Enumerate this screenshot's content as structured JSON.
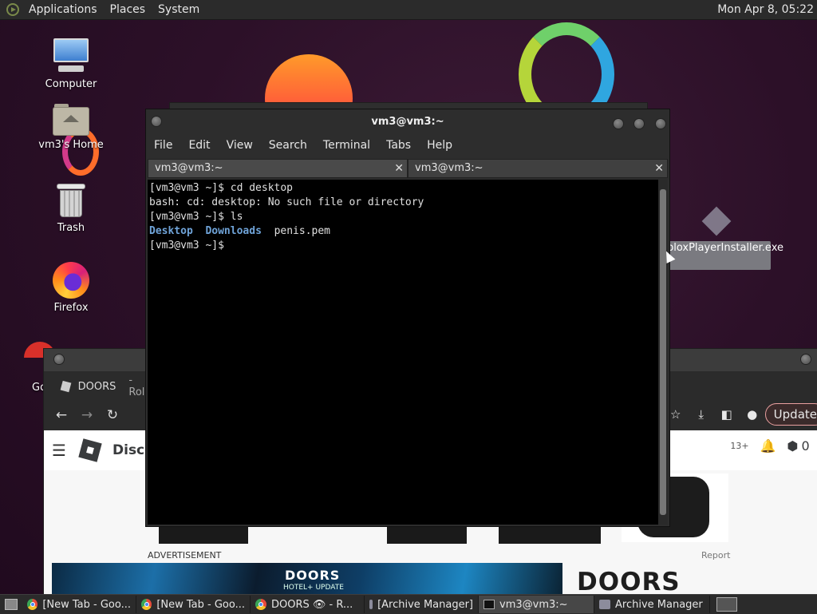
{
  "top_panel": {
    "menus": [
      "Applications",
      "Places",
      "System"
    ],
    "clock": "Mon Apr  8, 05:22"
  },
  "desktop": {
    "icons": [
      {
        "label": "Computer",
        "icon": "computer-icon"
      },
      {
        "label": "vm3's Home",
        "icon": "home-folder-icon"
      },
      {
        "label": "Trash",
        "icon": "trash-icon"
      },
      {
        "label": "Firefox",
        "icon": "firefox-icon"
      },
      {
        "label": "Go",
        "icon": "chrome-icon"
      }
    ],
    "file_label": "obloxPlayerInstaller.exe"
  },
  "terminal": {
    "title": "vm3@vm3:~",
    "menu": [
      "File",
      "Edit",
      "View",
      "Search",
      "Terminal",
      "Tabs",
      "Help"
    ],
    "tabs": [
      {
        "label": "vm3@vm3:~",
        "active": true
      },
      {
        "label": "vm3@vm3:~",
        "active": false
      }
    ],
    "lines": {
      "l1": "[vm3@vm3 ~]$ cd desktop",
      "l2": "bash: cd: desktop: No such file or directory",
      "l3": "[vm3@vm3 ~]$ ls",
      "l4_dir1": "Desktop",
      "l4_dir2": "Downloads",
      "l4_file": "penis.pem",
      "l5": "[vm3@vm3 ~]$ "
    },
    "dir_color": "#6fa3d8"
  },
  "browser": {
    "tab_title": "DOORS",
    "tab_suffix": "- Rol",
    "update_label": "Update",
    "site_header_text": "Disco",
    "age_badge": "13+",
    "robux": "0",
    "ad_label": "ADVERTISEMENT",
    "report_label": "Report",
    "banner_title": "DOORS",
    "banner_subtitle": "HOTEL+ UPDATE",
    "doors_heading": "DOORS"
  },
  "taskbar": {
    "items": [
      {
        "label": "[New Tab - Goo...",
        "icon": "chrome-icon",
        "active": false
      },
      {
        "label": "[New Tab - Goo...",
        "icon": "chrome-icon",
        "active": false
      },
      {
        "label": "DOORS 👁 - R...",
        "icon": "chrome-icon",
        "active": false
      },
      {
        "label": "[Archive Manager]",
        "icon": "archive-icon",
        "active": false
      },
      {
        "label": "vm3@vm3:~",
        "icon": "terminal-icon",
        "active": true
      },
      {
        "label": "Archive Manager",
        "icon": "archive-icon",
        "active": false
      }
    ]
  }
}
